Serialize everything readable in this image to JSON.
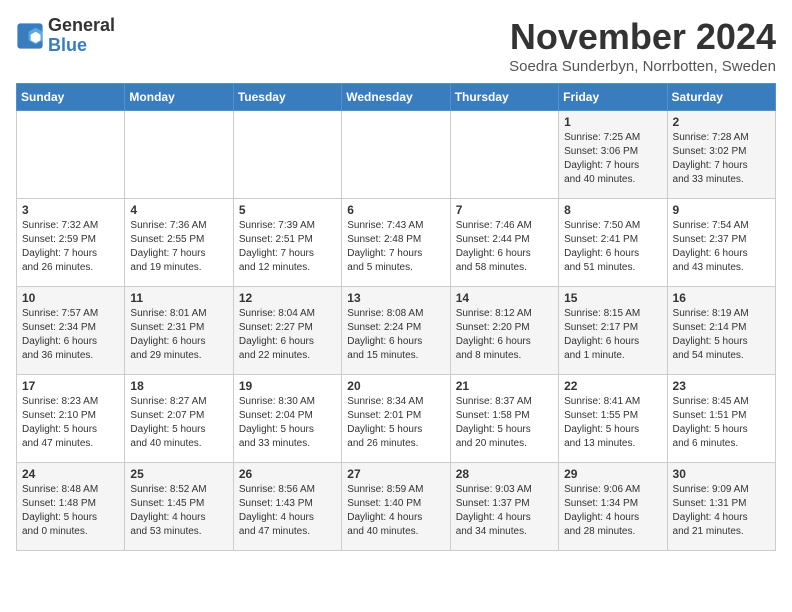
{
  "logo": {
    "line1": "General",
    "line2": "Blue"
  },
  "title": "November 2024",
  "subtitle": "Soedra Sunderbyn, Norrbotten, Sweden",
  "weekdays": [
    "Sunday",
    "Monday",
    "Tuesday",
    "Wednesday",
    "Thursday",
    "Friday",
    "Saturday"
  ],
  "weeks": [
    [
      {
        "day": "",
        "info": ""
      },
      {
        "day": "",
        "info": ""
      },
      {
        "day": "",
        "info": ""
      },
      {
        "day": "",
        "info": ""
      },
      {
        "day": "",
        "info": ""
      },
      {
        "day": "1",
        "info": "Sunrise: 7:25 AM\nSunset: 3:06 PM\nDaylight: 7 hours\nand 40 minutes."
      },
      {
        "day": "2",
        "info": "Sunrise: 7:28 AM\nSunset: 3:02 PM\nDaylight: 7 hours\nand 33 minutes."
      }
    ],
    [
      {
        "day": "3",
        "info": "Sunrise: 7:32 AM\nSunset: 2:59 PM\nDaylight: 7 hours\nand 26 minutes."
      },
      {
        "day": "4",
        "info": "Sunrise: 7:36 AM\nSunset: 2:55 PM\nDaylight: 7 hours\nand 19 minutes."
      },
      {
        "day": "5",
        "info": "Sunrise: 7:39 AM\nSunset: 2:51 PM\nDaylight: 7 hours\nand 12 minutes."
      },
      {
        "day": "6",
        "info": "Sunrise: 7:43 AM\nSunset: 2:48 PM\nDaylight: 7 hours\nand 5 minutes."
      },
      {
        "day": "7",
        "info": "Sunrise: 7:46 AM\nSunset: 2:44 PM\nDaylight: 6 hours\nand 58 minutes."
      },
      {
        "day": "8",
        "info": "Sunrise: 7:50 AM\nSunset: 2:41 PM\nDaylight: 6 hours\nand 51 minutes."
      },
      {
        "day": "9",
        "info": "Sunrise: 7:54 AM\nSunset: 2:37 PM\nDaylight: 6 hours\nand 43 minutes."
      }
    ],
    [
      {
        "day": "10",
        "info": "Sunrise: 7:57 AM\nSunset: 2:34 PM\nDaylight: 6 hours\nand 36 minutes."
      },
      {
        "day": "11",
        "info": "Sunrise: 8:01 AM\nSunset: 2:31 PM\nDaylight: 6 hours\nand 29 minutes."
      },
      {
        "day": "12",
        "info": "Sunrise: 8:04 AM\nSunset: 2:27 PM\nDaylight: 6 hours\nand 22 minutes."
      },
      {
        "day": "13",
        "info": "Sunrise: 8:08 AM\nSunset: 2:24 PM\nDaylight: 6 hours\nand 15 minutes."
      },
      {
        "day": "14",
        "info": "Sunrise: 8:12 AM\nSunset: 2:20 PM\nDaylight: 6 hours\nand 8 minutes."
      },
      {
        "day": "15",
        "info": "Sunrise: 8:15 AM\nSunset: 2:17 PM\nDaylight: 6 hours\nand 1 minute."
      },
      {
        "day": "16",
        "info": "Sunrise: 8:19 AM\nSunset: 2:14 PM\nDaylight: 5 hours\nand 54 minutes."
      }
    ],
    [
      {
        "day": "17",
        "info": "Sunrise: 8:23 AM\nSunset: 2:10 PM\nDaylight: 5 hours\nand 47 minutes."
      },
      {
        "day": "18",
        "info": "Sunrise: 8:27 AM\nSunset: 2:07 PM\nDaylight: 5 hours\nand 40 minutes."
      },
      {
        "day": "19",
        "info": "Sunrise: 8:30 AM\nSunset: 2:04 PM\nDaylight: 5 hours\nand 33 minutes."
      },
      {
        "day": "20",
        "info": "Sunrise: 8:34 AM\nSunset: 2:01 PM\nDaylight: 5 hours\nand 26 minutes."
      },
      {
        "day": "21",
        "info": "Sunrise: 8:37 AM\nSunset: 1:58 PM\nDaylight: 5 hours\nand 20 minutes."
      },
      {
        "day": "22",
        "info": "Sunrise: 8:41 AM\nSunset: 1:55 PM\nDaylight: 5 hours\nand 13 minutes."
      },
      {
        "day": "23",
        "info": "Sunrise: 8:45 AM\nSunset: 1:51 PM\nDaylight: 5 hours\nand 6 minutes."
      }
    ],
    [
      {
        "day": "24",
        "info": "Sunrise: 8:48 AM\nSunset: 1:48 PM\nDaylight: 5 hours\nand 0 minutes."
      },
      {
        "day": "25",
        "info": "Sunrise: 8:52 AM\nSunset: 1:45 PM\nDaylight: 4 hours\nand 53 minutes."
      },
      {
        "day": "26",
        "info": "Sunrise: 8:56 AM\nSunset: 1:43 PM\nDaylight: 4 hours\nand 47 minutes."
      },
      {
        "day": "27",
        "info": "Sunrise: 8:59 AM\nSunset: 1:40 PM\nDaylight: 4 hours\nand 40 minutes."
      },
      {
        "day": "28",
        "info": "Sunrise: 9:03 AM\nSunset: 1:37 PM\nDaylight: 4 hours\nand 34 minutes."
      },
      {
        "day": "29",
        "info": "Sunrise: 9:06 AM\nSunset: 1:34 PM\nDaylight: 4 hours\nand 28 minutes."
      },
      {
        "day": "30",
        "info": "Sunrise: 9:09 AM\nSunset: 1:31 PM\nDaylight: 4 hours\nand 21 minutes."
      }
    ]
  ]
}
